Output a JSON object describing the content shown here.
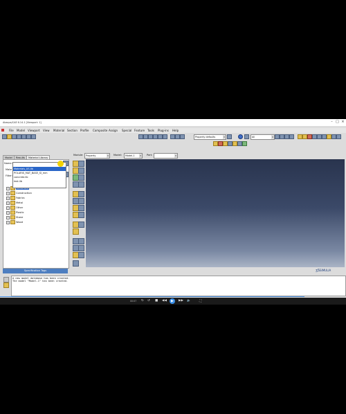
{
  "window": {
    "title": "Abaqus/CAE 6.14-1 [Viewport: 1]"
  },
  "menu": {
    "items": [
      "File",
      "Model",
      "Viewport",
      "View",
      "Material",
      "Section",
      "Profile",
      "Composite",
      "Assign",
      "Special",
      "Feature",
      "Tools",
      "Plug-ins",
      "Help"
    ]
  },
  "toolbar": {
    "property_defaults": "Property defaults",
    "all": "All"
  },
  "module_bar": {
    "module_label": "Module:",
    "module_value": "Property",
    "model_label": "Model:",
    "model_value": "Model-1",
    "part_label": "Part:",
    "part_value": ""
  },
  "left_panel": {
    "tabs": [
      "Model",
      "Results",
      "Material Library"
    ],
    "name_label": "Name:",
    "mate_label": "Mate",
    "filter_label": "Filter:",
    "dropdown_items": [
      "Materials_US.lib",
      "POLARIS_MAT_BASE_SI_mm",
      "concrete.lib",
      "test.lib"
    ],
    "tree": [
      "Ceramics",
      "Construction",
      "Fabrics",
      "Metal",
      "Other",
      "Plastic",
      "Stone",
      "Wood"
    ],
    "spec_tags": "Specification Tags"
  },
  "messages": [
    "A new model database has been created.",
    "The model \"Model-1\" has been created."
  ],
  "branding": {
    "simulia": "SIMULIA"
  },
  "player": {
    "timecode": "00:07"
  }
}
